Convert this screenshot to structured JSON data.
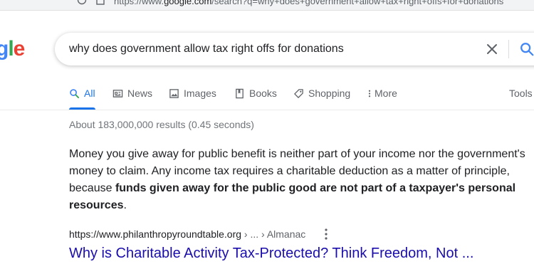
{
  "browser": {
    "url_prefix": "https://www.",
    "url_domain": "google.com",
    "url_rest": "/search?q=why+does+government+allow+tax+right+offs+for+donations"
  },
  "logo": {
    "part1": "g",
    "part2": "l",
    "part3": "e"
  },
  "search": {
    "query": "why does government allow tax right offs for donations"
  },
  "tabs": [
    {
      "label": "All",
      "icon": "search-icon"
    },
    {
      "label": "News",
      "icon": "news-icon"
    },
    {
      "label": "Images",
      "icon": "image-icon"
    },
    {
      "label": "Books",
      "icon": "book-icon"
    },
    {
      "label": "Shopping",
      "icon": "tag-icon"
    },
    {
      "label": "More",
      "icon": "more-vert-icon"
    }
  ],
  "tools_label": "Tools",
  "results_stats": "About 183,000,000 results (0.45 seconds)",
  "featured_snippet": {
    "text_normal": "Money you give away for public benefit is neither part of your income nor the government's money to claim. Any income tax requires a charitable deduction as a matter of principle, because ",
    "text_bold": "funds given away for the public good are not part of a taxpayer's personal resources",
    "text_end": "."
  },
  "source": {
    "site": "https://www.philanthropyroundtable.org",
    "path": " › ... › Almanac",
    "title": "Why is Charitable Activity Tax-Protected? Think Freedom, Not ..."
  },
  "colors": {
    "accent": "#1a73e8",
    "link": "#1a0dab",
    "muted": "#70757a"
  }
}
